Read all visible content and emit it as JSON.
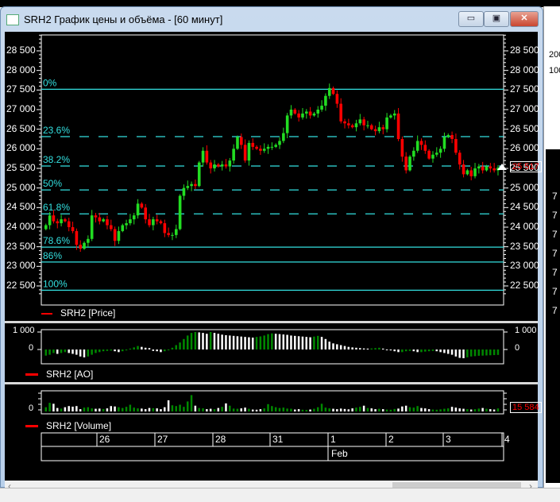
{
  "window": {
    "title": "SRH2 График цены и объёма - [60 минут]",
    "minimize": "▭",
    "maximize": "▣",
    "close": "✕"
  },
  "price_panel": {
    "legend": "SRH2 [Price]",
    "last_price": "25 517",
    "axis_labels": [
      "28 500",
      "28 000",
      "27 500",
      "27 000",
      "26 500",
      "26 000",
      "25 500",
      "25 000",
      "24 500",
      "24 000",
      "23 500",
      "23 000",
      "22 500"
    ]
  },
  "ao_panel": {
    "legend": "SRH2 [AO]",
    "axis_labels": [
      "1 000",
      "0"
    ]
  },
  "volume_panel": {
    "legend": "SRH2 [Volume]",
    "axis_zero": "0",
    "last_volume": "15 584"
  },
  "date_axis": {
    "days": [
      "26",
      "27",
      "28",
      "31",
      "1",
      "2",
      "3",
      "4"
    ],
    "month": "Feb"
  },
  "right_window": {
    "labels": [
      "200",
      "100"
    ],
    "rows": [
      "7",
      "7",
      "7",
      "7",
      "7",
      "7",
      "7"
    ]
  },
  "colors": {
    "up": "#22dd22",
    "down": "#ff0000",
    "fib": "#33e0e0",
    "ao_up": "#008800",
    "ao_down": "#ffffff",
    "vol_up": "#008800",
    "vol_down": "#ffffff",
    "last": "#ff0000"
  },
  "chart_data": {
    "type": "candlestick",
    "ylim": [
      22200,
      28900
    ],
    "fib_levels": [
      {
        "label": "0%",
        "value": 27520,
        "dashed": false
      },
      {
        "label": "23.6%",
        "value": 26310,
        "dashed": true
      },
      {
        "label": "38.2%",
        "value": 25560,
        "dashed": true
      },
      {
        "label": "50%",
        "value": 24950,
        "dashed": true
      },
      {
        "label": "61.8%",
        "value": 24340,
        "dashed": true
      },
      {
        "label": "78.6%",
        "value": 23490,
        "dashed": false
      },
      {
        "label": "86%",
        "value": 23110,
        "dashed": false
      },
      {
        "label": "100%",
        "value": 22390,
        "dashed": false
      }
    ],
    "close": [
      24050,
      24300,
      24150,
      24100,
      24200,
      24150,
      24000,
      23900,
      23550,
      23450,
      23600,
      23700,
      24300,
      24250,
      24150,
      24200,
      24050,
      23950,
      23650,
      23900,
      24050,
      24100,
      24200,
      24300,
      24600,
      24500,
      24200,
      24050,
      24200,
      24150,
      24100,
      23850,
      23800,
      23800,
      23950,
      24800,
      25000,
      25050,
      25100,
      25050,
      25650,
      25950,
      25650,
      25500,
      25600,
      25550,
      25600,
      25550,
      25700,
      26000,
      26300,
      26100,
      25700,
      26150,
      26050,
      26000,
      25950,
      26000,
      26050,
      26050,
      26100,
      26200,
      26400,
      26850,
      27000,
      26900,
      26800,
      26900,
      26950,
      26850,
      26900,
      27000,
      27100,
      27350,
      27550,
      27400,
      27150,
      26700,
      26650,
      26600,
      26550,
      26650,
      26750,
      26600,
      26600,
      26500,
      26450,
      26550,
      26500,
      26800,
      26850,
      26900,
      26250,
      25800,
      25450,
      25800,
      25950,
      26200,
      26100,
      25950,
      25750,
      25850,
      25900,
      26000,
      26300,
      26350,
      26250,
      25900,
      25600,
      25350,
      25450,
      25300,
      25500,
      25550,
      25450,
      25550,
      25500,
      25450,
      25517
    ],
    "ao": [
      -350,
      -300,
      -200,
      -250,
      -200,
      -150,
      -200,
      -250,
      -300,
      -400,
      -450,
      -400,
      -300,
      -200,
      -150,
      -100,
      -80,
      -60,
      -100,
      -150,
      -100,
      -50,
      50,
      120,
      200,
      150,
      100,
      80,
      -80,
      -100,
      -150,
      -100,
      0,
      100,
      250,
      400,
      600,
      800,
      950,
      1000,
      980,
      950,
      900,
      1000,
      950,
      900,
      850,
      820,
      800,
      780,
      760,
      740,
      720,
      700,
      680,
      720,
      750,
      800,
      880,
      920,
      900,
      880,
      860,
      840,
      800,
      780,
      760,
      740,
      720,
      700,
      740,
      780,
      720,
      600,
      450,
      350,
      300,
      250,
      200,
      150,
      120,
      100,
      80,
      60,
      50,
      60,
      80,
      100,
      50,
      0,
      -50,
      -100,
      -150,
      -150,
      -100,
      -80,
      -100,
      -150,
      -150,
      -120,
      -100,
      -80,
      -100,
      -150,
      -200,
      -250,
      -300,
      -400,
      -480,
      -500,
      -450,
      -400,
      -380,
      -360,
      -350,
      -340,
      -330,
      -320,
      -310
    ],
    "volume": [
      22000,
      45000,
      40000,
      18000,
      15000,
      22000,
      28000,
      25000,
      28000,
      12000,
      20000,
      22000,
      16000,
      14000,
      15000,
      13000,
      16000,
      28000,
      26000,
      22000,
      18000,
      24000,
      35000,
      20000,
      16000,
      15000,
      12000,
      18000,
      17000,
      16000,
      12000,
      22000,
      58000,
      32000,
      28000,
      35000,
      24000,
      52000,
      85000,
      30000,
      18000,
      16000,
      12000,
      14000,
      12000,
      18000,
      24000,
      42000,
      30000,
      15000,
      14000,
      16000,
      20000,
      14000,
      10000,
      9000,
      12000,
      16000,
      38000,
      28000,
      22000,
      18000,
      20000,
      15000,
      14000,
      10000,
      12000,
      9000,
      8000,
      10000,
      14000,
      22000,
      40000,
      20000,
      16000,
      14000,
      12000,
      15000,
      13000,
      11000,
      16000,
      20000,
      24000,
      30000,
      18000,
      16000,
      12000,
      14000,
      12000,
      10000,
      9000,
      13000,
      15000,
      26000,
      30000,
      22000,
      20000,
      28000,
      18000,
      16000,
      12000,
      10000,
      9000,
      11000,
      14000,
      16000,
      24000,
      20000,
      16000,
      14000,
      12000,
      10000,
      12000,
      15000,
      18000,
      14000,
      12000,
      10000,
      15584
    ]
  }
}
